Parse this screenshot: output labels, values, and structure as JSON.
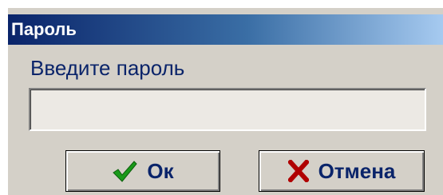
{
  "window": {
    "title": "Пароль"
  },
  "prompt": {
    "label": "Введите пароль"
  },
  "password": {
    "value": ""
  },
  "buttons": {
    "ok_label": "Ок",
    "ok_icon": "checkmark-icon",
    "cancel_label": "Отмена",
    "cancel_icon": "cross-icon"
  },
  "colors": {
    "title_bar_start": "#0a246a",
    "title_bar_end": "#a6caf0",
    "face": "#d4d0c8",
    "text": "#0a246a",
    "ok_icon": "#1a9a1a",
    "cancel_icon": "#b00000"
  }
}
